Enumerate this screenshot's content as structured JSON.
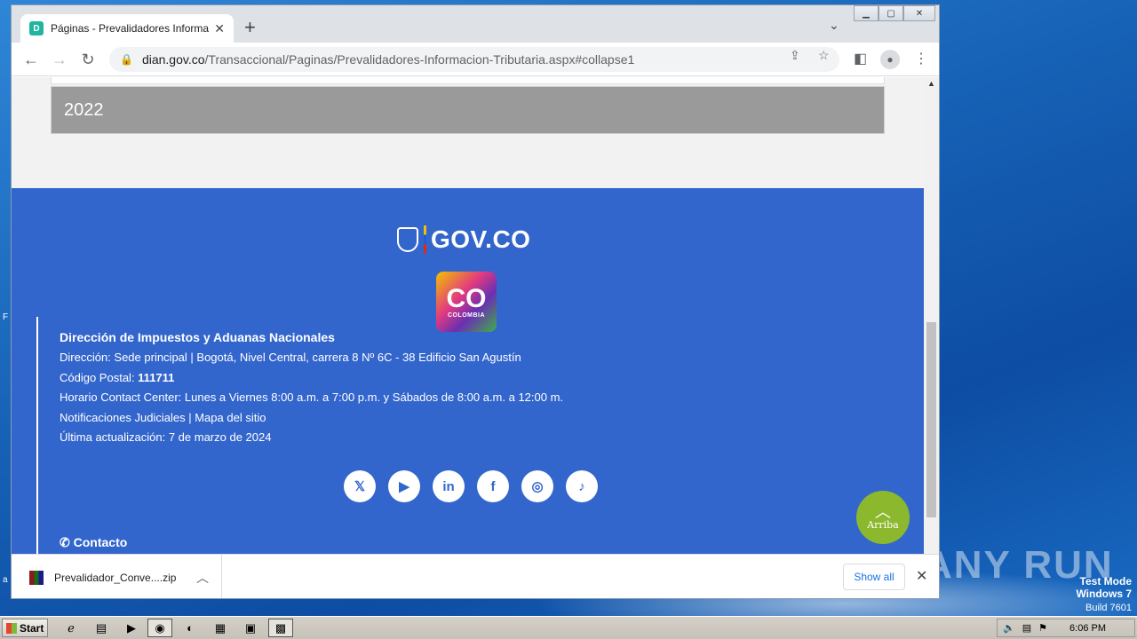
{
  "browser": {
    "tab_title": "Páginas - Prevalidadores Informacion",
    "tab_favicon": "D",
    "url_host": "dian.gov.co",
    "url_path": "/Transaccional/Paginas/Prevalidadores-Informacion-Tributaria.aspx#collapse1"
  },
  "page": {
    "accordion_year": "2022",
    "footer": {
      "govco_text": "GOV.CO",
      "co_logo_main": "CO",
      "co_logo_sub": "COLOMBIA",
      "entity_title": "Dirección de Impuestos y Aduanas Nacionales",
      "address": "Dirección: Sede principal | Bogotá, Nivel Central, carrera 8 Nº 6C - 38 Edificio San Agustín",
      "postal_label": "Código Postal: ",
      "postal_code": "111711",
      "hours": "Horario Contact Center: Lunes a Viernes 8:00 a.m. a 7:00 p.m. y Sábados de 8:00 a.m. a 12:00 m.",
      "links": "Notificaciones Judiciales | Mapa del sitio",
      "updated": "Última actualización: 7 de marzo de 2024",
      "contact_label": "Contacto",
      "socials": [
        {
          "icon": "x-icon",
          "glyph": "𝕏"
        },
        {
          "icon": "youtube-icon",
          "glyph": "▶"
        },
        {
          "icon": "linkedin-icon",
          "glyph": "in"
        },
        {
          "icon": "facebook-icon",
          "glyph": "f"
        },
        {
          "icon": "instagram-icon",
          "glyph": "◎"
        },
        {
          "icon": "tiktok-icon",
          "glyph": "♪"
        }
      ],
      "back_to_top": "Arriba"
    }
  },
  "downloads": {
    "file_name": "Prevalidador_Conve....zip",
    "show_all": "Show all"
  },
  "desktop": {
    "watermark": "ANY RUN",
    "test_mode": "Test Mode",
    "os_name": "Windows 7",
    "build": "Build 7601",
    "left_char_1": "F",
    "left_char_2": "a"
  },
  "taskbar": {
    "start_label": "Start",
    "clock": "6:06 PM"
  },
  "colors": {
    "footer_blue": "#3366cc",
    "arriba_green": "#8cb82d",
    "accordion_gray": "#9a9a9a"
  }
}
